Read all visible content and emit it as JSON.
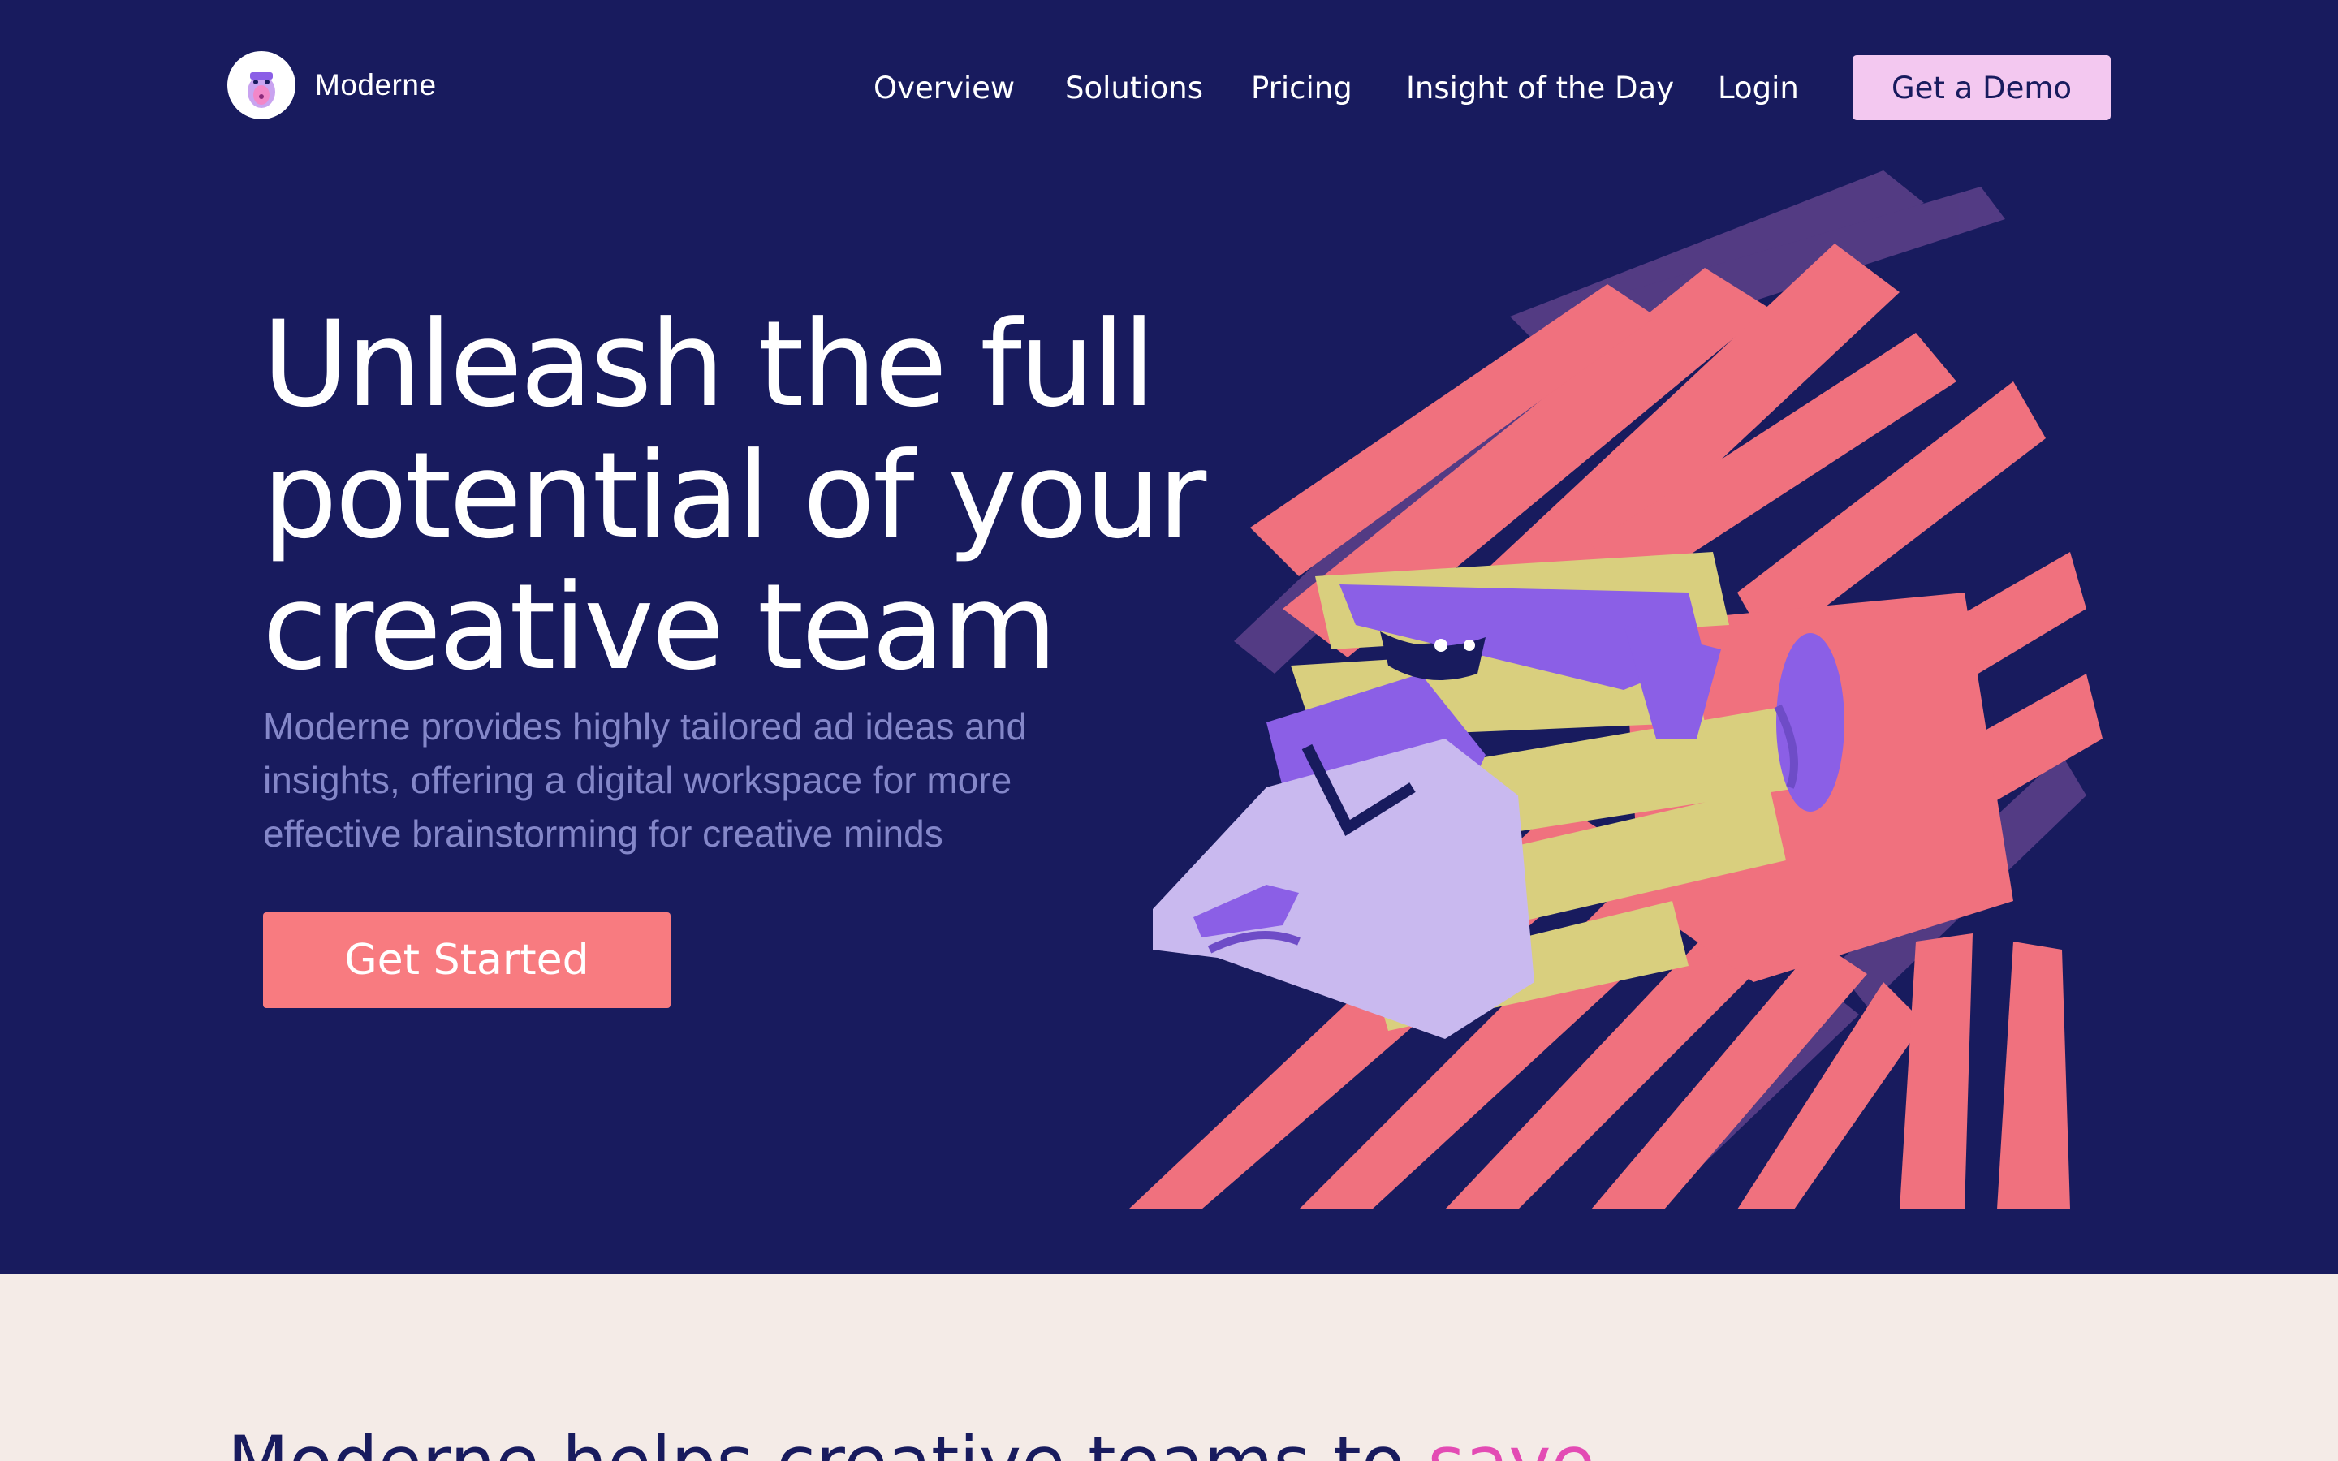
{
  "brand": {
    "name": "Moderne",
    "accent": "#f3c8f0"
  },
  "nav": {
    "items": [
      "Overview",
      "Solutions",
      "Pricing",
      "Insight of the Day",
      "Login"
    ],
    "demo_label": "Get a Demo"
  },
  "hero": {
    "headline": [
      "Unleash the full",
      "potential of your",
      "creative team"
    ],
    "subtext": [
      "Moderne provides highly tailored ad ideas and",
      "insights, offering a digital workspace for more",
      "effective brainstorming for creative minds"
    ],
    "cta_label": "Get Started",
    "illustration_icon": "gorilla-illustration"
  },
  "section": {
    "title_prefix": "Moderne helps creative teams to",
    "title_accent": "save"
  },
  "colors": {
    "hero_bg": "#181b5e",
    "cta_bg": "#f87b80",
    "section_bg": "#f4ebe7",
    "subtext": "#8487c9"
  }
}
